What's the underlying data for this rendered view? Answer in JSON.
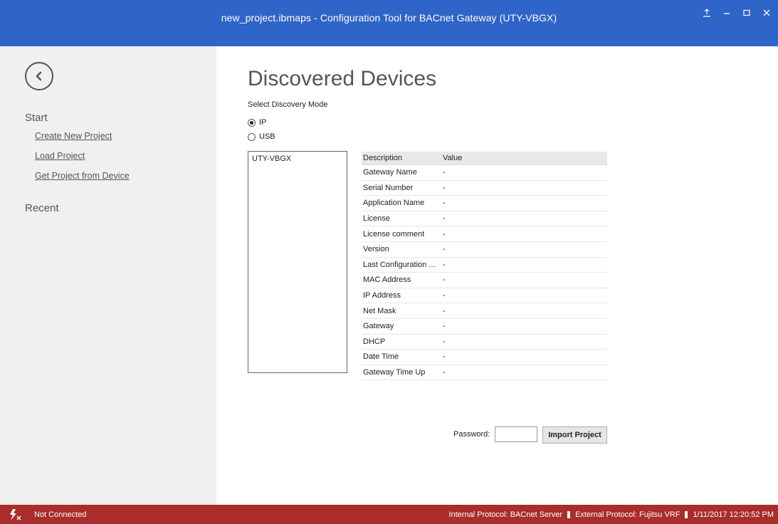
{
  "window": {
    "title": "new_project.ibmaps - Configuration Tool for BACnet Gateway (UTY-VBGX)"
  },
  "sidebar": {
    "start_heading": "Start",
    "links": [
      "Create New Project",
      "Load Project",
      "Get Project from Device"
    ],
    "recent_heading": "Recent"
  },
  "main": {
    "title": "Discovered Devices",
    "mode_label": "Select Discovery Mode",
    "modes": [
      {
        "label": "IP",
        "selected": true
      },
      {
        "label": "USB",
        "selected": false
      }
    ],
    "devices": [
      "UTY-VBGX"
    ],
    "table": {
      "headers": [
        "Description",
        "Value"
      ],
      "rows": [
        {
          "desc": "Gateway Name",
          "value": "-"
        },
        {
          "desc": "Serial Number",
          "value": "-"
        },
        {
          "desc": "Application Name",
          "value": "-"
        },
        {
          "desc": "License",
          "value": "-"
        },
        {
          "desc": "License comment",
          "value": "-"
        },
        {
          "desc": "Version",
          "value": "-"
        },
        {
          "desc": "Last Configuration ...",
          "value": "-"
        },
        {
          "desc": "MAC Address",
          "value": "-"
        },
        {
          "desc": "IP Address",
          "value": "-"
        },
        {
          "desc": "Net Mask",
          "value": "-"
        },
        {
          "desc": "Gateway",
          "value": "-"
        },
        {
          "desc": "DHCP",
          "value": "-"
        },
        {
          "desc": "Date Time",
          "value": "-"
        },
        {
          "desc": "Gateway Time Up",
          "value": "-"
        }
      ]
    },
    "password_label": "Password:",
    "password_value": "",
    "import_button": "Import Project"
  },
  "status": {
    "connection": "Not Connected",
    "internal_protocol": "Internal Protocol: BACnet Server",
    "external_protocol": "External Protocol: Fujitsu VRF",
    "datetime": "1/11/2017 12:20:52 PM"
  },
  "colors": {
    "titlebar": "#2f64c8",
    "sidebar": "#f0f0f0",
    "statusbar": "#a82d2b"
  }
}
